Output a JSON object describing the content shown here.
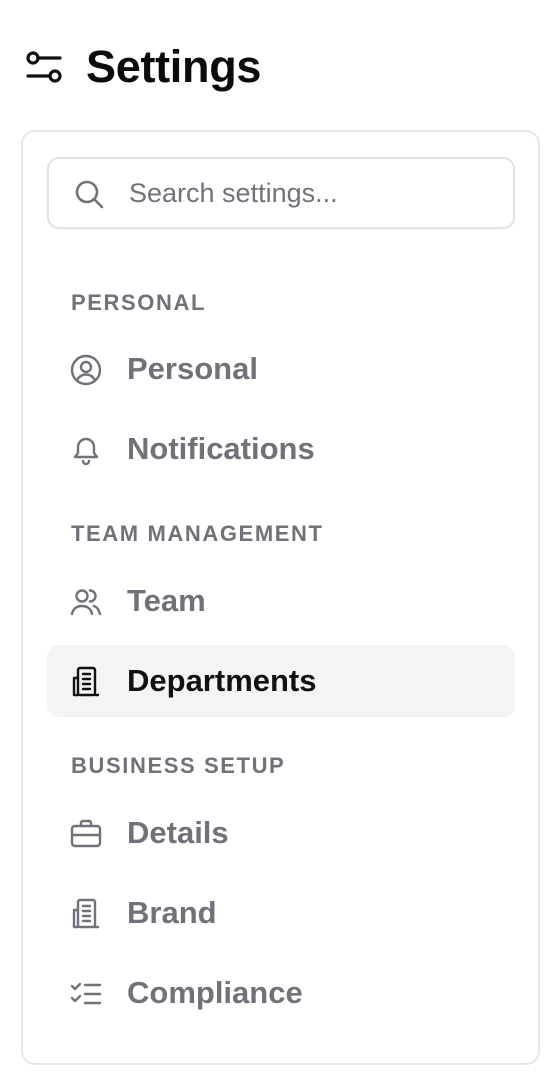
{
  "header": {
    "title": "Settings",
    "icon": "settings-sliders-icon"
  },
  "search": {
    "placeholder": "Search settings...",
    "value": ""
  },
  "sections": [
    {
      "label": "PERSONAL",
      "items": [
        {
          "label": "Personal",
          "icon": "user-circle-icon",
          "active": false
        },
        {
          "label": "Notifications",
          "icon": "bell-icon",
          "active": false
        }
      ]
    },
    {
      "label": "TEAM MANAGEMENT",
      "items": [
        {
          "label": "Team",
          "icon": "users-icon",
          "active": false
        },
        {
          "label": "Departments",
          "icon": "building-icon",
          "active": true
        }
      ]
    },
    {
      "label": "BUSINESS SETUP",
      "items": [
        {
          "label": "Details",
          "icon": "briefcase-icon",
          "active": false
        },
        {
          "label": "Brand",
          "icon": "building-icon",
          "active": false
        },
        {
          "label": "Compliance",
          "icon": "list-checks-icon",
          "active": false
        }
      ]
    }
  ],
  "colors": {
    "muted": "#71717a",
    "active_bg": "#f4f4f5",
    "text": "#111111",
    "border": "#e6e6e6"
  }
}
